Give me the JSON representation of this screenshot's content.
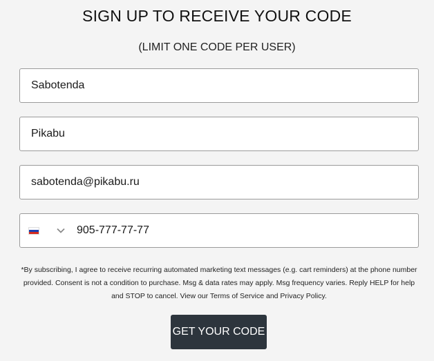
{
  "header": {
    "title": "SIGN UP TO RECEIVE YOUR CODE",
    "subtitle": "(LIMIT ONE CODE PER USER)"
  },
  "form": {
    "first_name": {
      "value": "Sabotenda"
    },
    "last_name": {
      "value": "Pikabu"
    },
    "email": {
      "value": "sabotenda@pikabu.ru"
    },
    "phone": {
      "country_flag": "russia-flag-icon",
      "flag_colors": [
        "#ffffff",
        "#1c3fb0",
        "#d52b1e"
      ],
      "value": "905-777-77-77"
    }
  },
  "disclaimer": {
    "text_before": "*By subscribing, I agree to receive recurring automated marketing text messages (e.g. cart reminders) at the phone number provided. Consent is not a condition to purchase. Msg & data rates may apply. Msg frequency varies. Reply HELP for help and STOP to cancel. View our ",
    "terms_link": "Terms of Service",
    "and_text": " and ",
    "privacy_link": "Privacy Policy",
    "end_text": "."
  },
  "cta": {
    "label": "GET YOUR CODE",
    "bg_color": "#2d353d"
  }
}
